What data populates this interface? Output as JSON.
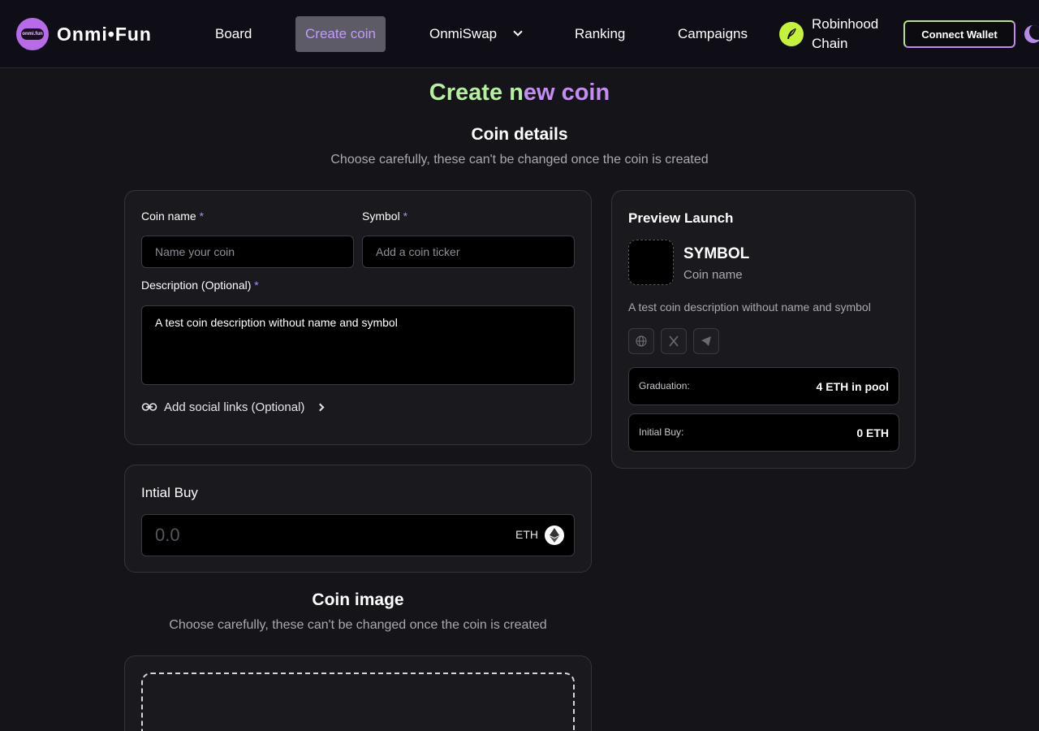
{
  "header": {
    "logo_badge": "onmi.fun",
    "logo_text": "Onmi•Fun",
    "nav": {
      "board": "Board",
      "create_coin": "Create coin",
      "onmiswap": "OnmiSwap",
      "ranking": "Ranking",
      "campaigns": "Campaigns"
    },
    "chain_label": "Robinhood Chain",
    "connect_wallet": "Connect Wallet"
  },
  "page": {
    "title_part1": "Create n",
    "title_part2": "ew coin"
  },
  "coin_details": {
    "title": "Coin details",
    "subtitle": "Choose carefully, these can't be changed once the coin is created",
    "coin_name_label": "Coin name",
    "required_mark": "*",
    "coin_name_placeholder": "Name your coin",
    "symbol_label": "Symbol",
    "symbol_placeholder": "Add a coin ticker",
    "description_label": "Description (Optional)",
    "description_value": "A test coin description without name and symbol",
    "social_links": "Add social links (Optional)"
  },
  "initial_buy": {
    "title": "Intial Buy",
    "placeholder": "0.0",
    "unit": "ETH"
  },
  "coin_image": {
    "title": "Coin image",
    "subtitle": "Choose carefully, these can't be changed once the coin is created"
  },
  "preview": {
    "title": "Preview Launch",
    "symbol": "SYMBOL",
    "name": "Coin name",
    "description": "A test coin description without name and symbol",
    "graduation_label": "Graduation:",
    "graduation_value": "4 ETH in pool",
    "initial_buy_label": "Initial Buy:",
    "initial_buy_value": "0 ETH"
  },
  "colors": {
    "accent_purple": "#c38ef0",
    "accent_green": "#b7eea0",
    "active_nav_bg": "#5d5b66",
    "chain_icon": "#c5f23a"
  },
  "icons": {
    "globe": "globe-icon",
    "x": "x-twitter-icon",
    "telegram": "telegram-icon",
    "link": "link-icon",
    "eth": "eth-icon",
    "moon": "moon-icon"
  }
}
